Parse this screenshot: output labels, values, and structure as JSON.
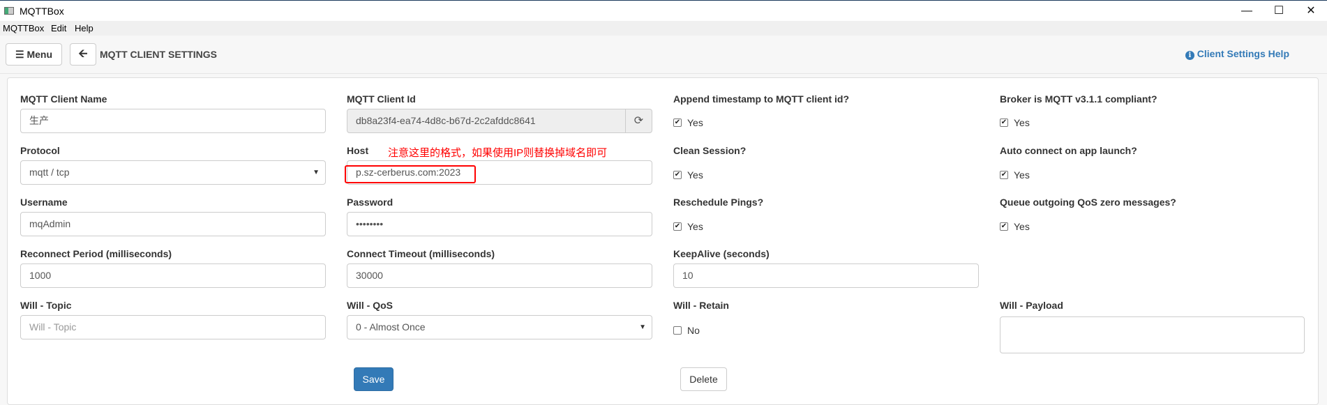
{
  "window": {
    "title": "MQTTBox",
    "controls": [
      "minimize",
      "maximize",
      "close"
    ]
  },
  "menubar": [
    "MQTTBox",
    "Edit",
    "Help"
  ],
  "toolbar": {
    "menu_label": "Menu",
    "page_title": "MQTT CLIENT SETTINGS",
    "help_label": "Client Settings Help"
  },
  "form": {
    "client_name": {
      "label": "MQTT Client Name",
      "value": "生产"
    },
    "client_id": {
      "label": "MQTT Client Id",
      "value": "db8a23f4-ea74-4d8c-b67d-2c2afddc8641"
    },
    "append_timestamp": {
      "label": "Append timestamp to MQTT client id?",
      "checked": true,
      "text": "Yes"
    },
    "broker_compliant": {
      "label": "Broker is MQTT v3.1.1 compliant?",
      "checked": true,
      "text": "Yes"
    },
    "protocol": {
      "label": "Protocol",
      "value": "mqtt / tcp"
    },
    "host": {
      "label": "Host",
      "value": "p.sz-cerberus.com:2023"
    },
    "clean_session": {
      "label": "Clean Session?",
      "checked": true,
      "text": "Yes"
    },
    "auto_connect": {
      "label": "Auto connect on app launch?",
      "checked": true,
      "text": "Yes"
    },
    "username": {
      "label": "Username",
      "value": "mqAdmin"
    },
    "password": {
      "label": "Password",
      "value": "••••••••"
    },
    "reschedule_pings": {
      "label": "Reschedule Pings?",
      "checked": true,
      "text": "Yes"
    },
    "queue_qos0": {
      "label": "Queue outgoing QoS zero messages?",
      "checked": true,
      "text": "Yes"
    },
    "reconnect_period": {
      "label": "Reconnect Period (milliseconds)",
      "value": "1000"
    },
    "connect_timeout": {
      "label": "Connect Timeout (milliseconds)",
      "value": "30000"
    },
    "keepalive": {
      "label": "KeepAlive (seconds)",
      "value": "10"
    },
    "will_topic": {
      "label": "Will - Topic",
      "placeholder": "Will - Topic"
    },
    "will_qos": {
      "label": "Will - QoS",
      "value": "0 - Almost Once"
    },
    "will_retain": {
      "label": "Will - Retain",
      "checked": false,
      "text": "No"
    },
    "will_payload": {
      "label": "Will - Payload",
      "value": ""
    }
  },
  "buttons": {
    "save": "Save",
    "delete": "Delete"
  },
  "annotation": {
    "text": "注意这里的格式，如果使用IP则替换掉域名即可",
    "color": "#ff0000"
  },
  "colors": {
    "primary": "#337ab7",
    "link": "#337ab7"
  }
}
